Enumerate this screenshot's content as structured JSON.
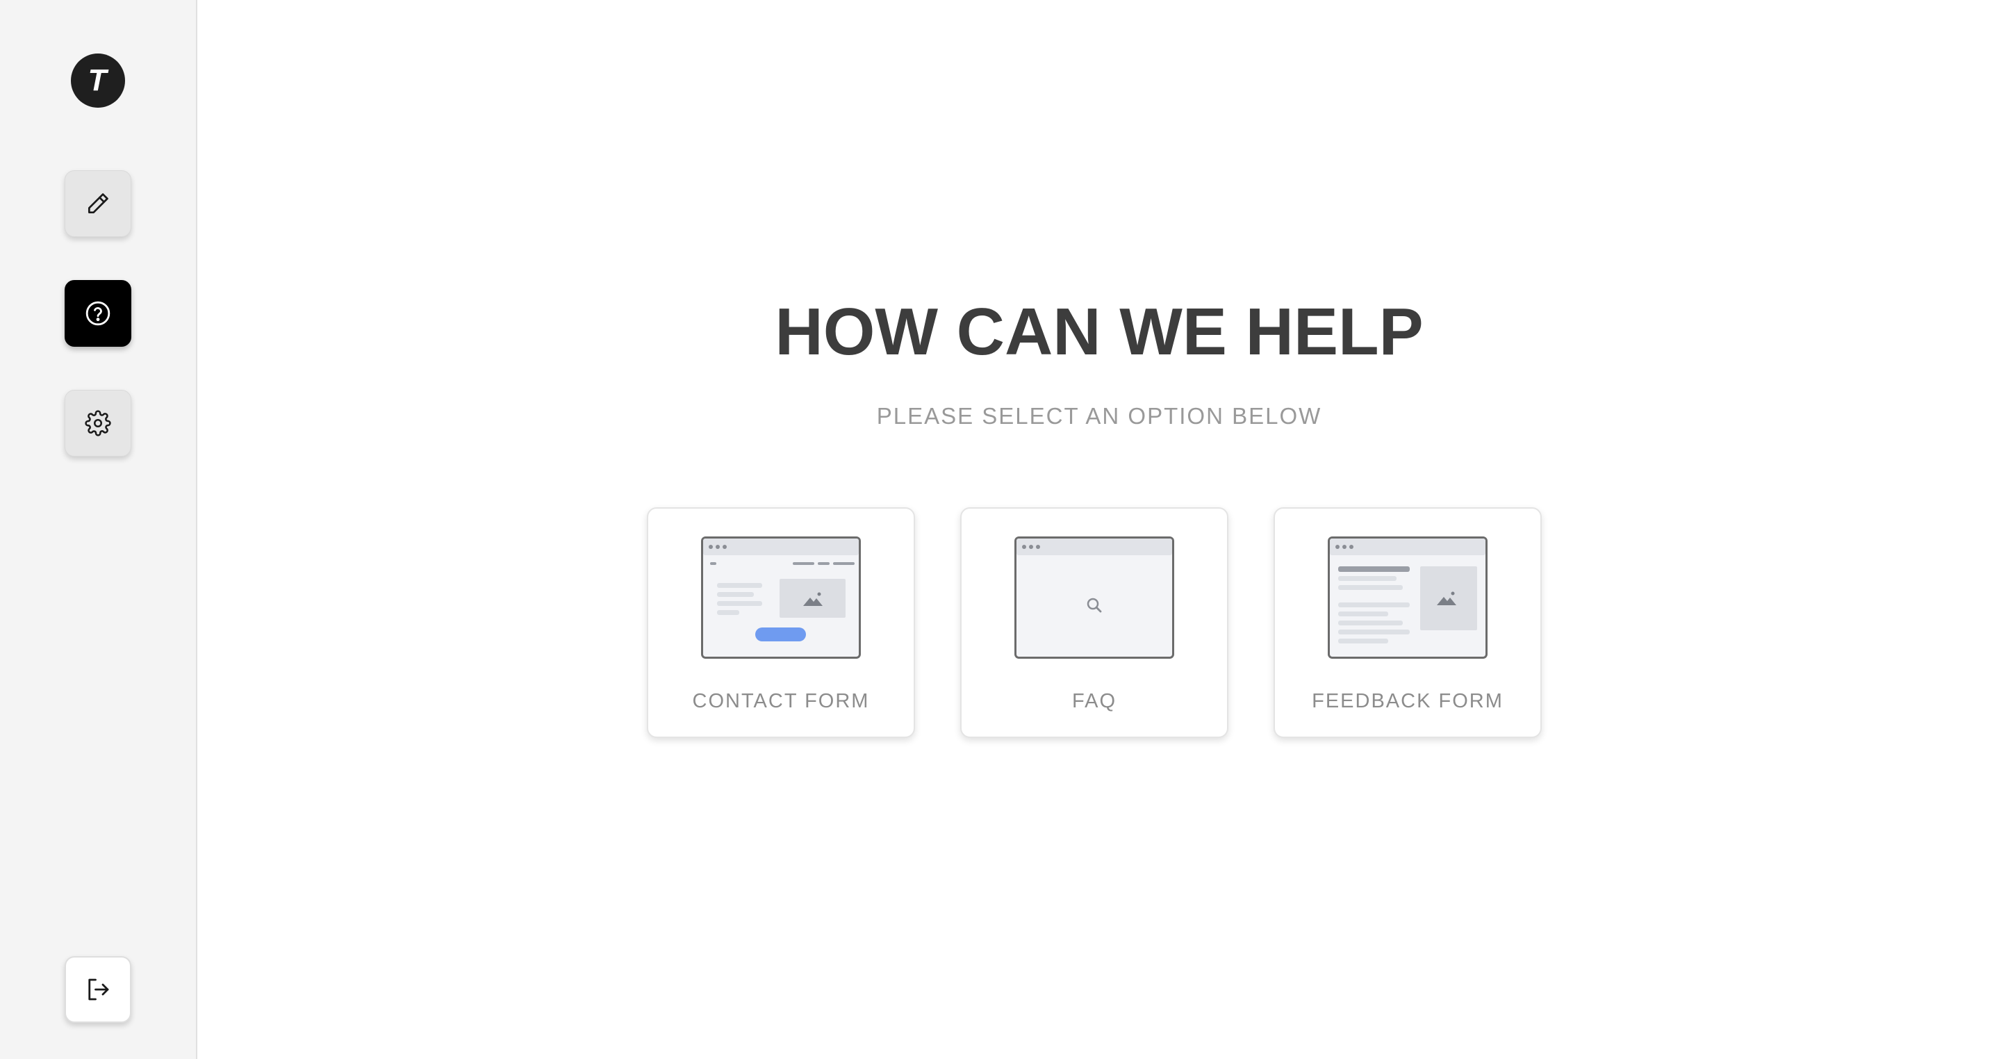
{
  "brand": {
    "logo_letter": "T",
    "icon": "t-logo-icon"
  },
  "sidebar": {
    "items": [
      {
        "id": "edit",
        "icon": "pencil-icon",
        "active": false
      },
      {
        "id": "help",
        "icon": "help-circle-icon",
        "active": true
      },
      {
        "id": "settings",
        "icon": "gear-icon",
        "active": false
      }
    ],
    "logout": {
      "icon": "logout-icon"
    }
  },
  "main": {
    "title": "HOW CAN WE HELP",
    "subtitle": "PLEASE SELECT AN OPTION BELOW",
    "options": [
      {
        "label": "CONTACT FORM",
        "illustration": "contact-form-wireframe"
      },
      {
        "label": "FAQ",
        "illustration": "faq-search-wireframe"
      },
      {
        "label": "FEEDBACK FORM",
        "illustration": "feedback-form-wireframe"
      }
    ]
  },
  "colors": {
    "sidebar_bg": "#f4f4f4",
    "active_button": "#000000",
    "title": "#3d3d3d",
    "subtitle": "#999999",
    "accent_button": "#6f9bf0"
  }
}
